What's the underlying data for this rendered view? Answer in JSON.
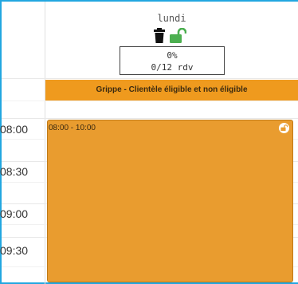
{
  "day": {
    "name": "lundi",
    "percent": "0%",
    "appointments": "0/12 rdv"
  },
  "banner": {
    "label": "Grippe - Clientèle éligible et non éligible",
    "color": "#ef9a1e"
  },
  "times": [
    "08:00",
    "08:30",
    "09:00",
    "09:30"
  ],
  "event": {
    "time_range": "08:00 - 10:00",
    "color": "#e99c2f"
  },
  "icons": {
    "delete": "trash-icon",
    "lock": "unlock-icon",
    "event_lock": "unlock-icon"
  },
  "colors": {
    "frame": "#22a7e0",
    "lock": "#4caf50"
  }
}
